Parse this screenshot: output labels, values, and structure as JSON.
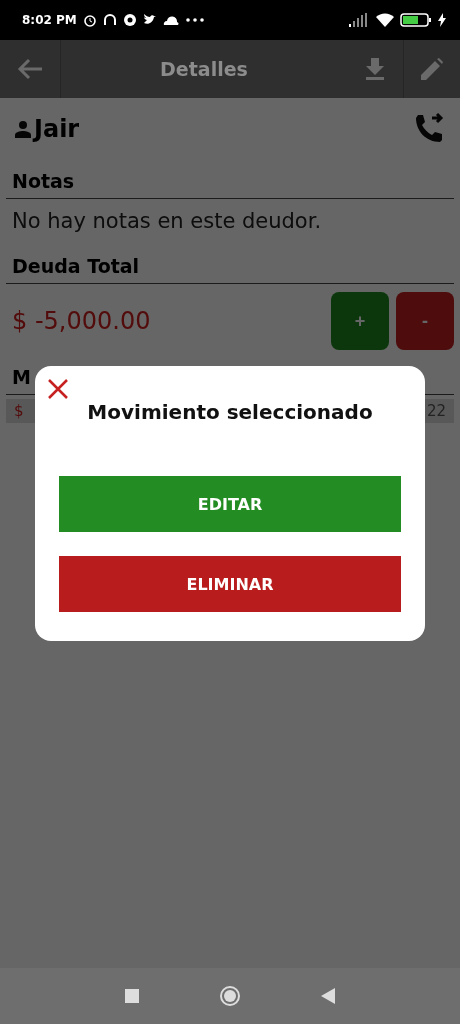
{
  "status_bar": {
    "time": "8:02 PM"
  },
  "app_bar": {
    "title": "Detalles"
  },
  "debtor": {
    "name": "Jair"
  },
  "notes": {
    "heading": "Notas",
    "text": "No hay notas en este deudor."
  },
  "debt": {
    "heading": "Deuda Total",
    "amount": "$ -5,000.00",
    "buttons": [
      {
        "label": "+",
        "kind": "add"
      },
      {
        "label": "-",
        "kind": "subtract"
      }
    ]
  },
  "movements": {
    "heading": "M",
    "rows": [
      {
        "amount": "$",
        "date": "22"
      }
    ]
  },
  "dialog": {
    "title": "Movimiento seleccionado",
    "actions": [
      {
        "label": "EDITAR",
        "kind": "edit"
      },
      {
        "label": "ELIMINAR",
        "kind": "delete"
      }
    ]
  }
}
